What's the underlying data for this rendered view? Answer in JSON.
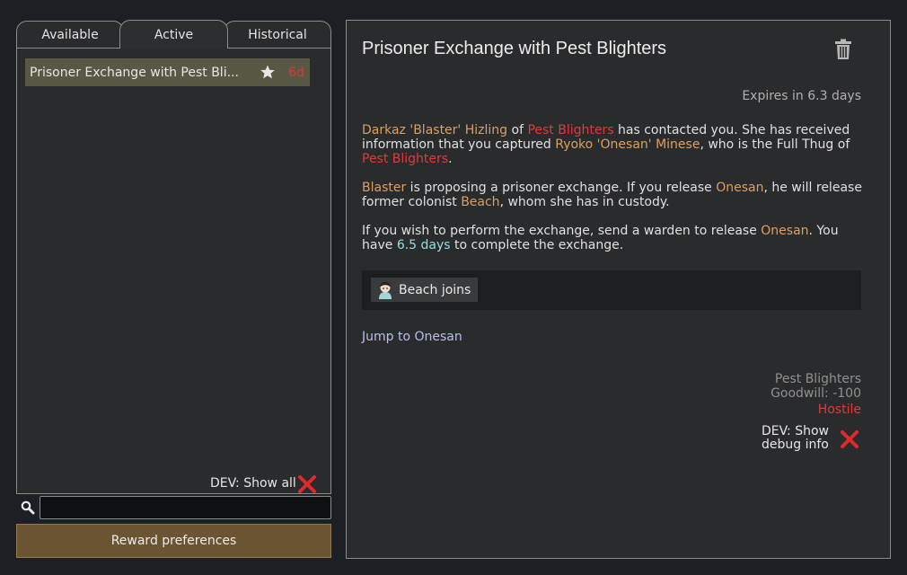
{
  "tabs": [
    {
      "label": "Available",
      "active": false
    },
    {
      "label": "Active",
      "active": true
    },
    {
      "label": "Historical",
      "active": false
    }
  ],
  "quest_list": [
    {
      "title": "Prisoner Exchange with Pest Bli...",
      "days": "6d",
      "starred": true,
      "selected": true
    }
  ],
  "dev_show_all": "DEV: Show all",
  "search": {
    "value": "",
    "placeholder": ""
  },
  "reward_preferences_label": "Reward preferences",
  "detail": {
    "title": "Prisoner Exchange with Pest Blighters",
    "expires": "Expires in 6.3 days",
    "p1": {
      "a": "Darkaz 'Blaster' Hizling",
      "b": " of ",
      "c": "Pest Blighters",
      "d": " has contacted you. She has received information that you captured ",
      "e": "Ryoko 'Onesan' Minese",
      "f": ", who is the Full Thug of ",
      "g": "Pest Blighters",
      "h": "."
    },
    "p2": {
      "a": "Blaster",
      "b": " is proposing a prisoner exchange. If you release ",
      "c": "Onesan",
      "d": ", he will release former colonist ",
      "e": "Beach",
      "f": ", whom she has in custody."
    },
    "p3": {
      "a": "If you wish to perform the exchange, send a warden to release ",
      "b": "Onesan",
      "c": ". You have ",
      "d": "6.5 days",
      "e": " to complete the exchange."
    },
    "reward": "Beach joins",
    "jump_link": "Jump to Onesan",
    "faction": {
      "name": "Pest Blighters",
      "goodwill": "Goodwill: -100",
      "relation": "Hostile"
    },
    "dev_debug": "DEV: Show debug info"
  },
  "colors": {
    "highlight_name": "#d9a063",
    "faction_red": "#e03a3a",
    "time_cyan": "#8fe0e0",
    "selected_row": "#585845",
    "button_brown": "#6a5431"
  }
}
